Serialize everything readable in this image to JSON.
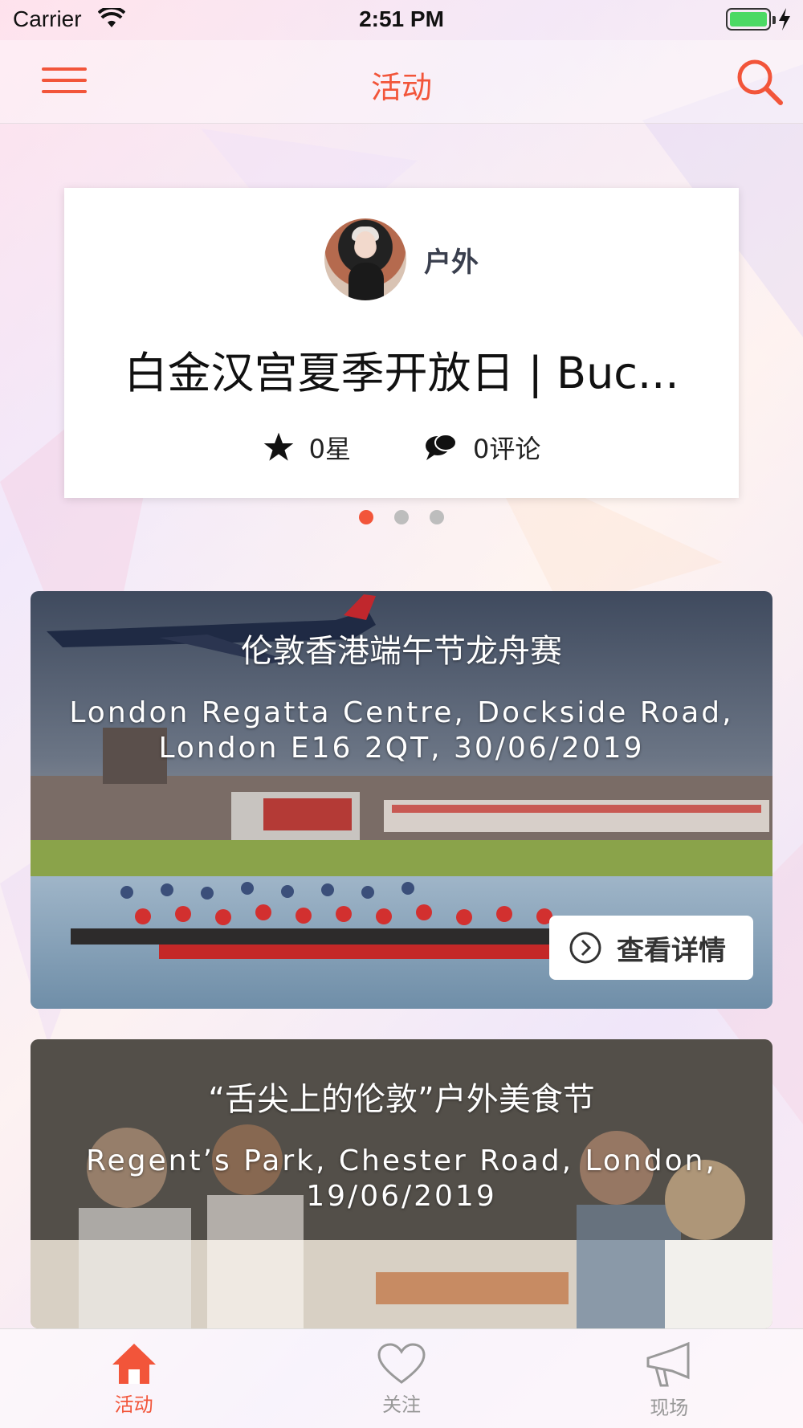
{
  "status_bar": {
    "carrier": "Carrier",
    "time": "2:51 PM",
    "battery_color": "#4cd964"
  },
  "nav": {
    "title": "活动",
    "accent_color": "#f2553a"
  },
  "featured": {
    "category": "户外",
    "title": "白金汉宫夏季开放日 | Buc...",
    "stars": "0星",
    "comments": "0评论"
  },
  "pager": {
    "count": 3,
    "active_index": 0
  },
  "events": [
    {
      "title": "伦敦香港端午节龙舟赛",
      "subtitle": "London Regatta Centre, Dockside Road, London E16 2QT, 30/06/2019",
      "button_label": "查看详情"
    },
    {
      "title": "“舌尖上的伦敦”户外美食节",
      "subtitle": "Regent’s Park, Chester Road, London, 19/06/2019"
    }
  ],
  "tabs": [
    {
      "label": "活动",
      "icon": "home-icon",
      "active": true
    },
    {
      "label": "关注",
      "icon": "heart-icon",
      "active": false
    },
    {
      "label": "现场",
      "icon": "megaphone-icon",
      "active": false
    }
  ]
}
